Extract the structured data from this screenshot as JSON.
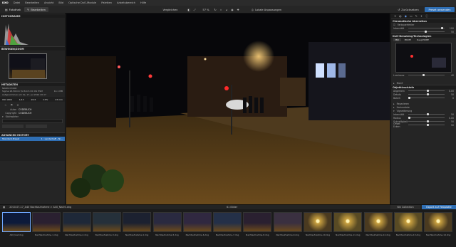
{
  "app": {
    "logo": "DXO",
    "menu": [
      "Datei",
      "Bearbeiten",
      "Ansicht",
      "Bild",
      "Optische DxO-Module",
      "Paletten",
      "Arbeitsbereich",
      "Hilfe"
    ]
  },
  "toolbar": {
    "tab_photothek": "Fotothek",
    "tab_bearbeiten": "Bearbeiten",
    "compare": "Vergleichen",
    "zoom": "57 %",
    "local": "Lokale Anpassungen",
    "reset": "Zurücksetzen",
    "export": "Preset anwenden"
  },
  "left": {
    "histogram_title": "HISTOGRAMM",
    "navigator_title": "BEWEGEN/ZOOM",
    "meta_title": "METADATEN",
    "meta_lines": [
      "NIKON D3000",
      "Sigma 18-50mm f/2.8-4.5 DC OS HSM",
      "Aufgenommen am Sa, 17. Jul 2010 20:17"
    ],
    "meta_size": "14.1 MB",
    "exif": [
      "ISO 1600",
      "1/13",
      "f/4.5",
      "0 EV",
      "23 mm"
    ],
    "author_label": "Autor",
    "author_value": "CODEBUCH",
    "copyright_label": "Copyright",
    "copyright_value": "CODEBUCH",
    "stack_label": "Stichwörter",
    "history_title": "ADVANCED HISTORY",
    "history_items": [
      "Standard-Preset",
      "1 : Landschaft - Ni..."
    ]
  },
  "right": {
    "section_ca": "Chromatische Aberration",
    "ca_opt1": "Farbquerfehler",
    "ca_opt2": "Intensität",
    "ca_val1": "100",
    "ca_val2": "50",
    "denoise": "DxO-Denoising-Technologien",
    "denoise_mode": "HQ",
    "denoise_modes": [
      "HQ",
      "PRIME",
      "DeepPRIME"
    ],
    "lum_label": "Luminanz",
    "lum_val": "40",
    "moire": "Moiré",
    "sharpen": "Objektivschärfe",
    "sharp_labels": [
      "Allgemein",
      "Details",
      "Bokeh"
    ],
    "sharp_vals": [
      "0.00",
      "50",
      "0"
    ],
    "repair": "Reparieren",
    "horizon": "Horizontale",
    "vignette": "Vignettierung",
    "distortion": [
      "Intensität",
      "Radius",
      "Schnelligkeit",
      "Offset Ecken"
    ],
    "distortion_vals": [
      "50",
      "0.00",
      "50",
      "50"
    ],
    "nik": "Nik Collection",
    "export_btn": "Export auf Festplatte"
  },
  "filmstrip": {
    "path": "2010-07-17_A40 Nachtaufnahme > A40_Nacht.dng",
    "count": "61 Bilder",
    "thumbs": [
      "A40_test.dng",
      "Nachtaufnahme-1.dng",
      "Nachtaufnahme-2.dng",
      "Nachtaufnahme-3.dng",
      "Nachtaufnahme-4.dng",
      "Nachtaufnahme-5.dng",
      "Nachtaufnahme-6.dng",
      "Nachtaufnahme-7.dng",
      "Nachtaufnahme-8.dng",
      "Nachtaufnahme-9.dng",
      "Nachtaufnahme-10.dng",
      "Nachtaufnahme-11.dng",
      "Nachtaufnahme-12.dng",
      "Nachtaufnahme-13.dng",
      "Nachtaufnahme-14.dng"
    ]
  },
  "colors": {
    "accent": "#2f6fb5",
    "panel": "#252525",
    "viewer": "#1a1a1a"
  }
}
